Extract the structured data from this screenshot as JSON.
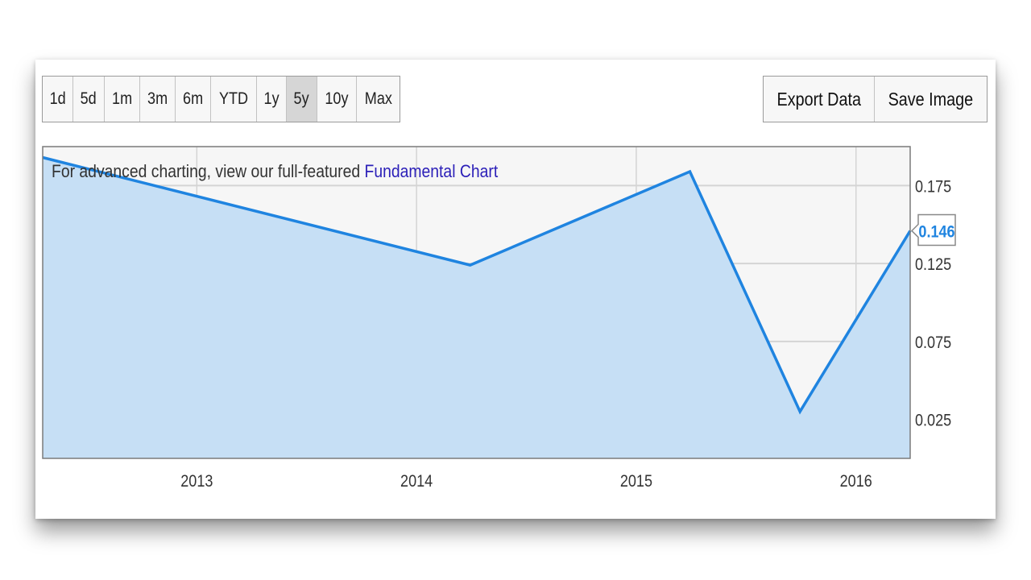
{
  "toolbar": {
    "ranges": [
      {
        "label": "1d",
        "active": false
      },
      {
        "label": "5d",
        "active": false
      },
      {
        "label": "1m",
        "active": false
      },
      {
        "label": "3m",
        "active": false
      },
      {
        "label": "6m",
        "active": false
      },
      {
        "label": "YTD",
        "active": false
      },
      {
        "label": "1y",
        "active": false
      },
      {
        "label": "5y",
        "active": true
      },
      {
        "label": "10y",
        "active": false
      },
      {
        "label": "Max",
        "active": false
      }
    ],
    "export_label": "Export Data",
    "save_label": "Save Image"
  },
  "note": {
    "text": "For advanced charting, view our full-featured",
    "link": "Fundamental Chart"
  },
  "colors": {
    "line": "#1f84e0",
    "fill": "#c6dff5",
    "plot_bg": "#f6f6f6",
    "grid": "#d4d4d4",
    "link": "#2b1fb8"
  },
  "chart_data": {
    "type": "area",
    "x": [
      "2012-04-20",
      "2014-03-31",
      "2015-03-31",
      "2015-09-30",
      "2016-03-31"
    ],
    "values": [
      0.193,
      0.124,
      0.184,
      0.03,
      0.146
    ],
    "last_value_label": "0.146",
    "x_ticks": [
      "2013",
      "2014",
      "2015",
      "2016"
    ],
    "y_ticks": [
      "0.025",
      "0.075",
      "0.125",
      "0.175"
    ],
    "ylim": [
      0.0,
      0.2
    ],
    "xlim": [
      "2012-04-20",
      "2016-03-31"
    ],
    "grid": true,
    "axis_position": "right"
  }
}
